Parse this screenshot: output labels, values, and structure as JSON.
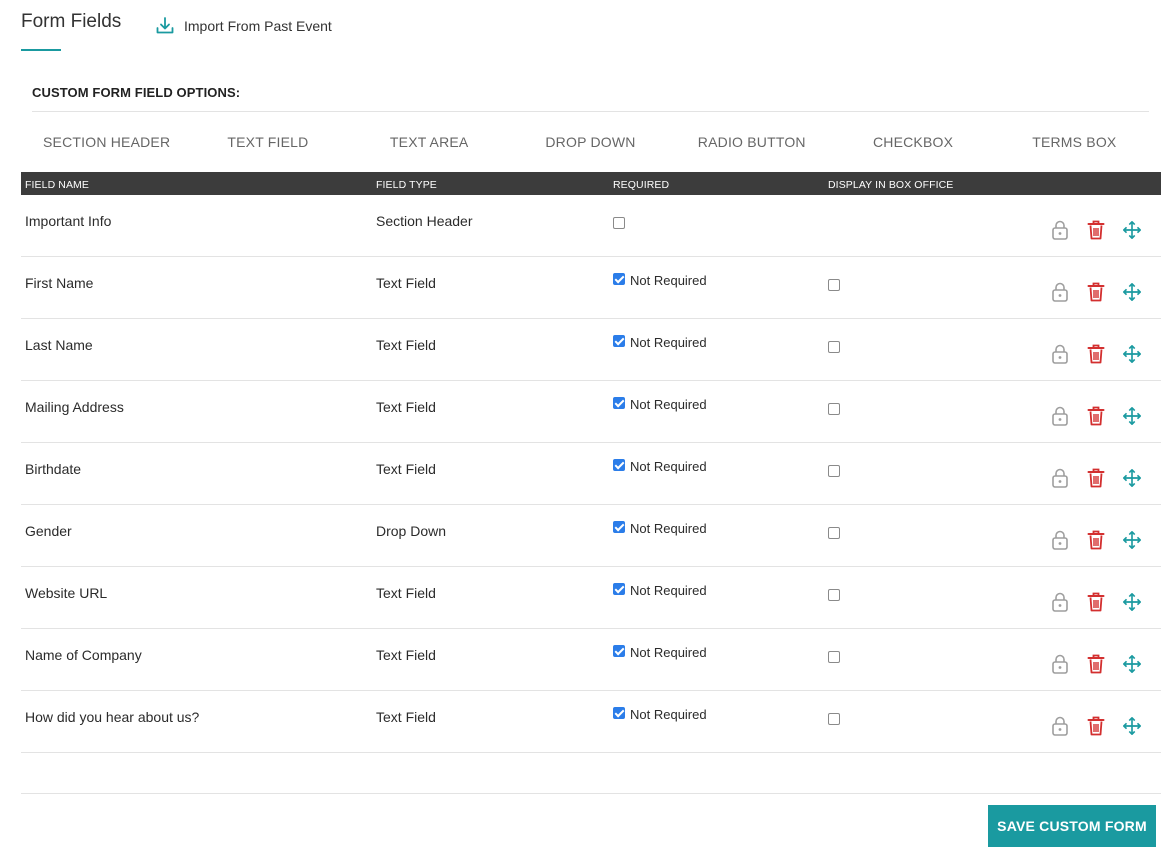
{
  "header": {
    "title": "Form Fields",
    "import_label": "Import From Past Event"
  },
  "options": {
    "title": "CUSTOM FORM FIELD OPTIONS:",
    "types": [
      "SECTION HEADER",
      "TEXT FIELD",
      "TEXT AREA",
      "DROP DOWN",
      "RADIO BUTTON",
      "CHECKBOX",
      "TERMS BOX"
    ]
  },
  "table": {
    "columns": {
      "field_name": "FIELD NAME",
      "field_type": "FIELD TYPE",
      "required": "REQUIRED",
      "display_box_office": "DISPLAY IN BOX OFFICE"
    },
    "rows": [
      {
        "name": "Important Info",
        "type": "Section Header",
        "required_checked": false,
        "required_label": "",
        "box_office": false
      },
      {
        "name": "First Name",
        "type": "Text Field",
        "required_checked": true,
        "required_label": "Not Required",
        "box_office": false
      },
      {
        "name": "Last Name",
        "type": "Text Field",
        "required_checked": true,
        "required_label": "Not Required",
        "box_office": false
      },
      {
        "name": "Mailing Address",
        "type": "Text Field",
        "required_checked": true,
        "required_label": "Not Required",
        "box_office": false
      },
      {
        "name": "Birthdate",
        "type": "Text Field",
        "required_checked": true,
        "required_label": "Not Required",
        "box_office": false
      },
      {
        "name": "Gender",
        "type": "Drop Down",
        "required_checked": true,
        "required_label": "Not Required",
        "box_office": false
      },
      {
        "name": "Website URL",
        "type": "Text Field",
        "required_checked": true,
        "required_label": "Not Required",
        "box_office": false
      },
      {
        "name": "Name of Company",
        "type": "Text Field",
        "required_checked": true,
        "required_label": "Not Required",
        "box_office": false
      },
      {
        "name": "How did you hear about us?",
        "type": "Text Field",
        "required_checked": true,
        "required_label": "Not Required",
        "box_office": false
      }
    ]
  },
  "icons": {
    "import": "download-icon",
    "lock": "lock-icon",
    "delete": "trash-icon",
    "move": "move-arrows-icon"
  },
  "colors": {
    "accent": "#1a9aa0",
    "delete": "#d32f2f",
    "lock": "#9e9e9e",
    "header_bg": "#3c3c3c",
    "checkbox": "#2b7de9"
  },
  "footer": {
    "save_label": "SAVE CUSTOM FORM"
  }
}
